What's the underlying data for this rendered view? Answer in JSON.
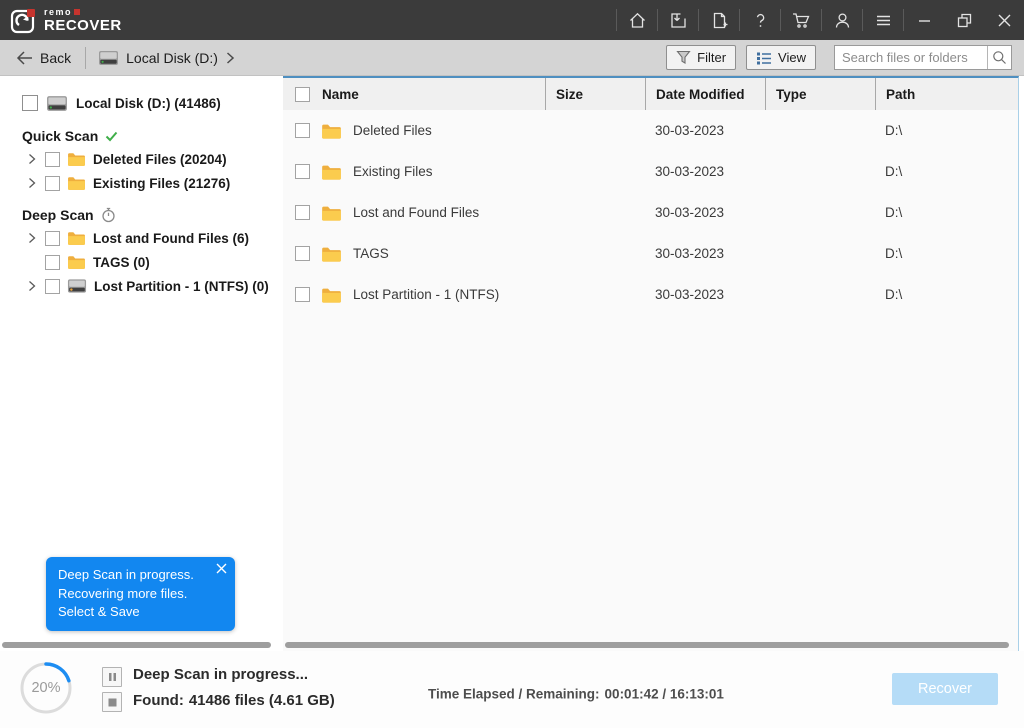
{
  "titlebar": {
    "brand_top": "remo",
    "brand_bottom": "RECOVER"
  },
  "toolbar": {
    "back_label": "Back",
    "location_label": "Local Disk (D:)",
    "filter_label": "Filter",
    "view_label": "View",
    "search_placeholder": "Search files or folders"
  },
  "sidebar": {
    "root_label": "Local Disk (D:) (41486)",
    "quick_scan_label": "Quick Scan",
    "deep_scan_label": "Deep Scan",
    "quick_items": [
      {
        "label": "Deleted Files (20204)"
      },
      {
        "label": "Existing Files (21276)"
      }
    ],
    "deep_items": [
      {
        "label": "Lost and Found Files (6)"
      },
      {
        "label": "TAGS (0)"
      },
      {
        "label": "Lost Partition - 1 (NTFS) (0)"
      }
    ],
    "notification": {
      "lines": [
        "Deep Scan in progress.",
        "Recovering more files.",
        "Select & Save"
      ],
      "close_icon": "close-icon"
    }
  },
  "table": {
    "columns": [
      "Name",
      "Size",
      "Date Modified",
      "Type",
      "Path"
    ],
    "rows": [
      {
        "name": "Deleted Files",
        "size": "",
        "date": "30-03-2023",
        "type": "",
        "path": "D:\\"
      },
      {
        "name": "Existing Files",
        "size": "",
        "date": "30-03-2023",
        "type": "",
        "path": "D:\\"
      },
      {
        "name": "Lost and Found Files",
        "size": "",
        "date": "30-03-2023",
        "type": "",
        "path": "D:\\"
      },
      {
        "name": "TAGS",
        "size": "",
        "date": "30-03-2023",
        "type": "",
        "path": "D:\\"
      },
      {
        "name": "Lost Partition - 1 (NTFS)",
        "size": "",
        "date": "30-03-2023",
        "type": "",
        "path": "D:\\"
      }
    ]
  },
  "statusbar": {
    "progress_percent": "20%",
    "line1": "Deep Scan in progress...",
    "line2_label": "Found:",
    "line2_value": "41486 files (4.61 GB)",
    "time_label": "Time Elapsed / Remaining:",
    "time_value": "00:01:42 / 16:13:01",
    "recover_label": "Recover"
  },
  "colors": {
    "accent_blue": "#1287f0",
    "brand_red": "#c6342e",
    "folder_yellow": "#fbcc4e",
    "success_green": "#3fae49",
    "titlebar_dark": "#3b3b3b",
    "recover_disabled": "#b5dcf7"
  }
}
